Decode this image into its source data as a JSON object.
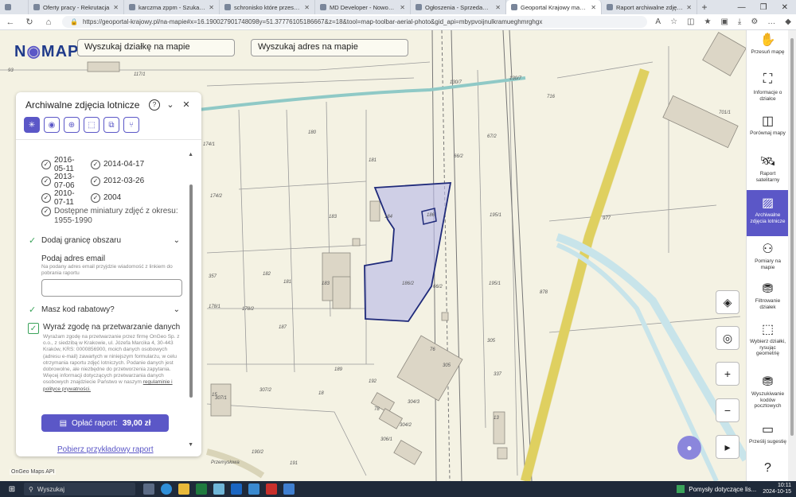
{
  "browser": {
    "tabs": [
      {
        "title": "Oferty pracy - Rekrutacja",
        "active": false
      },
      {
        "title": "karczma zppm - Szukaj w Goo",
        "active": false
      },
      {
        "title": "schronisko które przestało istn",
        "active": false
      },
      {
        "title": "MD Developer - Nowoczesne m",
        "active": false
      },
      {
        "title": "Ogłoszenia - Sprzedam, kupię n",
        "active": false
      },
      {
        "title": "Geoportal Krajowy mapy i infor",
        "active": true
      },
      {
        "title": "Raport archiwalne zdjęcia lotnic",
        "active": false
      }
    ],
    "url": "https://geoportal-krajowy.pl/na-mapie#x=16.190027901748098y=51.37776105186667&z=18&tool=map-toolbar-aerial-photo&gid_api=mbypvoijnulkramueghmrghgx"
  },
  "map": {
    "logo": {
      "left": "N",
      "pin": "◉",
      "right": "MAPIE"
    },
    "search_parcel": "Wyszukaj działkę na mapie",
    "search_address": "Wyszukaj adres na mapie",
    "attribution": "OnGeo Maps API",
    "labels": [
      "93",
      "117/1",
      "130/7",
      "130/7",
      "174/1",
      "180",
      "181",
      "66/2",
      "67/2",
      "716",
      "701/1",
      "174/2",
      "183",
      "184",
      "186",
      "195/1",
      "977",
      "182",
      "181",
      "183",
      "357",
      "186/2",
      "178/1",
      "178/2",
      "66/2",
      "195/1",
      "878",
      "187",
      "305",
      "76",
      "305",
      "337",
      "189",
      "192",
      "15",
      "307/1",
      "307/2",
      "18",
      "304/3",
      "78",
      "304/2",
      "13",
      "306/1",
      "190/2",
      "191",
      "Przemysłowa"
    ]
  },
  "panel": {
    "title": "Archiwalne zdjęcia lotnicze",
    "help_icon": "?",
    "collapse_icon": "⌄",
    "close_icon": "✕",
    "dates": [
      [
        "2016-05-11",
        "2014-04-17"
      ],
      [
        "2013-07-06",
        "2012-03-26"
      ],
      [
        "2010-07-11",
        "2004"
      ]
    ],
    "mini_label": "Dostępne miniatury zdjęć z okresu: 1955-1990",
    "area_border": "Dodaj granicę obszaru",
    "email_label": "Podaj adres email",
    "email_hint": "Na podany adres email przyjdzie wiadomość z linkiem do pobrania raportu",
    "email_value": "",
    "discount": "Masz kod rabatowy?",
    "consent_title": "Wyraź zgodę na przetwarzanie danych",
    "consent_text": "Wyrażam zgodę na przetwarzanie przez firmę OnGeo Sp. z o.o., z siedzibą w Krakowie, ul. Józefa Marcika 4, 30-443 Kraków, KRS: 0000856900, moich danych osobowych (adresu e-mail) zawartych w niniejszym formularzu, w celu otrzymania raportu zdjęć lotniczych. Podanie danych jest dobrowolne, ale niezbędne do przetworzenia zapytania. Więcej informacji dotyczących przetwarzania danych osobowych znajdziecie Państwo w naszym",
    "consent_link": "regulaminie i polityce prywatności.",
    "pay_label": "Opłać raport:",
    "pay_price": "39,00 zł",
    "sample_link": "Pobierz przykładowy raport"
  },
  "sidebar": [
    {
      "label": "Przesuń mapę",
      "icon": "✋"
    },
    {
      "label": "Informacje o działce",
      "icon": "⛶"
    },
    {
      "label": "Porównaj mapy",
      "icon": "◫"
    },
    {
      "label": "Raport satelitarny",
      "icon": "🛰"
    },
    {
      "label": "Archiwalne zdjęcia lotnicze",
      "icon": "▨"
    },
    {
      "label": "Pomiary na mapie",
      "icon": "⚇"
    },
    {
      "label": "Filtrowanie działek",
      "icon": "⛃"
    },
    {
      "label": "Wybierz działki, rysując geometrię",
      "icon": "⬚"
    },
    {
      "label": "Wyszukiwanie kodów pocztowych",
      "icon": "⛃"
    },
    {
      "label": "Prześlij sugestię",
      "icon": "▭"
    },
    {
      "label": "",
      "icon": "?"
    }
  ],
  "taskbar": {
    "search": "Wyszukaj",
    "notification": "Pomysły dotyczące lis...",
    "time": "10:11",
    "date": "2024-10-15"
  },
  "colors": {
    "accent": "#5b57c7",
    "check": "#3aa35a"
  }
}
